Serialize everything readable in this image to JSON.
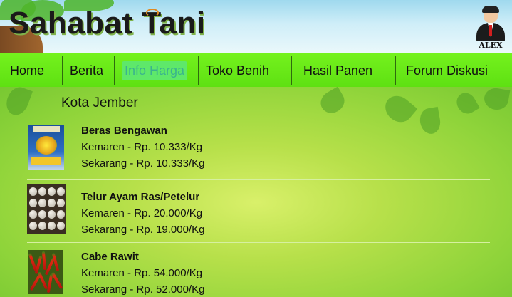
{
  "header": {
    "brand": "Sahabat Tani",
    "user": {
      "name": "ALEX",
      "icon": "user-avatar-icon"
    }
  },
  "nav": {
    "items": [
      {
        "label": "Home"
      },
      {
        "label": "Berita"
      },
      {
        "label": "Info Harga",
        "active": true
      },
      {
        "label": "Toko Benih"
      },
      {
        "label": "Hasil Panen"
      },
      {
        "label": "Forum Diskusi"
      }
    ]
  },
  "content": {
    "city": "Kota Jember",
    "products": [
      {
        "name": "Beras Bengawan",
        "prev": "Kemaren - Rp. 10.333/Kg",
        "now": "Sekarang - Rp. 10.333/Kg",
        "image": "rice-bag"
      },
      {
        "name": "Telur Ayam Ras/Petelur",
        "prev": "Kemaren - Rp. 20.000/Kg",
        "now": "Sekarang - Rp. 19.000/Kg",
        "image": "eggs"
      },
      {
        "name": "Cabe Rawit",
        "prev": "Kemaren - Rp. 54.000/Kg",
        "now": "Sekarang - Rp. 52.000/Kg",
        "image": "chili"
      }
    ]
  },
  "colors": {
    "nav_bg": "#74f21d",
    "active_tab": "#5ee86a",
    "active_text": "#3ab38e"
  }
}
